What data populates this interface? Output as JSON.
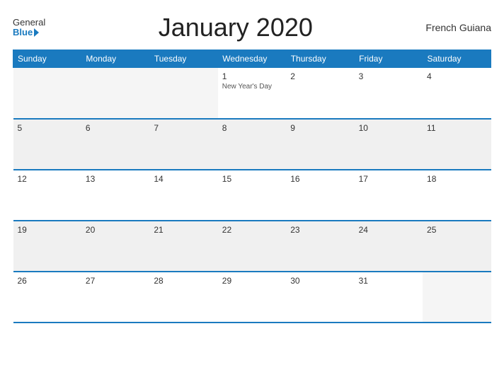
{
  "header": {
    "logo_general": "General",
    "logo_blue": "Blue",
    "title": "January 2020",
    "region": "French Guiana"
  },
  "days_of_week": [
    "Sunday",
    "Monday",
    "Tuesday",
    "Wednesday",
    "Thursday",
    "Friday",
    "Saturday"
  ],
  "weeks": [
    [
      {
        "day": "",
        "empty": true
      },
      {
        "day": "",
        "empty": true
      },
      {
        "day": "",
        "empty": true
      },
      {
        "day": "1",
        "holiday": "New Year's Day"
      },
      {
        "day": "2"
      },
      {
        "day": "3"
      },
      {
        "day": "4"
      }
    ],
    [
      {
        "day": "5"
      },
      {
        "day": "6"
      },
      {
        "day": "7"
      },
      {
        "day": "8"
      },
      {
        "day": "9"
      },
      {
        "day": "10"
      },
      {
        "day": "11"
      }
    ],
    [
      {
        "day": "12"
      },
      {
        "day": "13"
      },
      {
        "day": "14"
      },
      {
        "day": "15"
      },
      {
        "day": "16"
      },
      {
        "day": "17"
      },
      {
        "day": "18"
      }
    ],
    [
      {
        "day": "19"
      },
      {
        "day": "20"
      },
      {
        "day": "21"
      },
      {
        "day": "22"
      },
      {
        "day": "23"
      },
      {
        "day": "24"
      },
      {
        "day": "25"
      }
    ],
    [
      {
        "day": "26"
      },
      {
        "day": "27"
      },
      {
        "day": "28"
      },
      {
        "day": "29"
      },
      {
        "day": "30"
      },
      {
        "day": "31"
      },
      {
        "day": "",
        "empty": true
      }
    ]
  ],
  "colors": {
    "header_bg": "#1a7abf",
    "border": "#1a7abf",
    "logo_blue": "#1a7abf"
  }
}
